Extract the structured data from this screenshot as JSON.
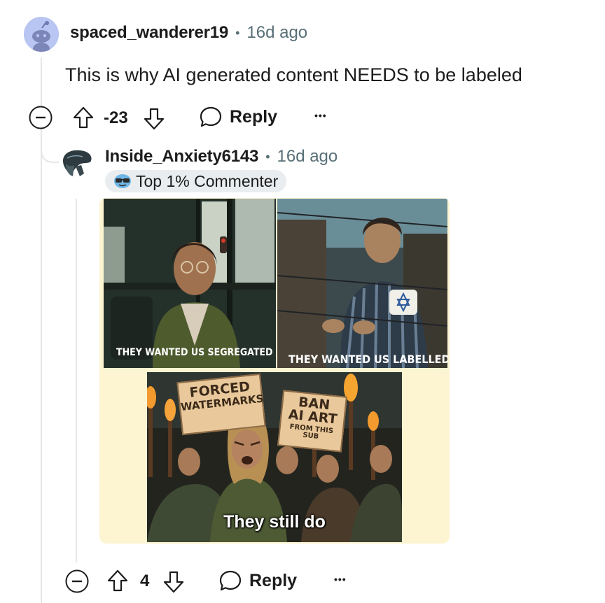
{
  "comment1": {
    "username": "spaced_wanderer19",
    "separator": "•",
    "age": "16d ago",
    "body": "This is why AI generated content NEEDS to be labeled",
    "vote_count": "-23",
    "reply_label": "Reply",
    "more_label": "•••"
  },
  "comment2": {
    "username": "Inside_Anxiety6143",
    "separator": "•",
    "age": "16d ago",
    "flair": "Top 1% Commenter",
    "vote_count": "4",
    "reply_label": "Reply",
    "more_label": "•••",
    "meme": {
      "panel1_caption": "THEY WANTED US SEGREGATED",
      "panel2_caption": "THEY WANTED US LABELLED",
      "sign1": [
        "FORCED",
        "WATERMARKS"
      ],
      "sign2": [
        "BAN",
        "AI ART",
        "FROM THIS SUB"
      ],
      "panel3_caption": "They still do"
    }
  },
  "colors": {
    "text": "#1c1c1c",
    "meta": "#576f76",
    "thread_line": "#e4e6e8",
    "flair_bg": "#eaedef",
    "meme_bg": "#fdf5d2",
    "avatar1_bg": "#b9c5f2"
  },
  "icons": [
    "collapse-icon",
    "upvote-icon",
    "downvote-icon",
    "reply-bubble-icon",
    "more-icon",
    "snoo-avatar-icon",
    "flair-sunglasses-icon"
  ]
}
